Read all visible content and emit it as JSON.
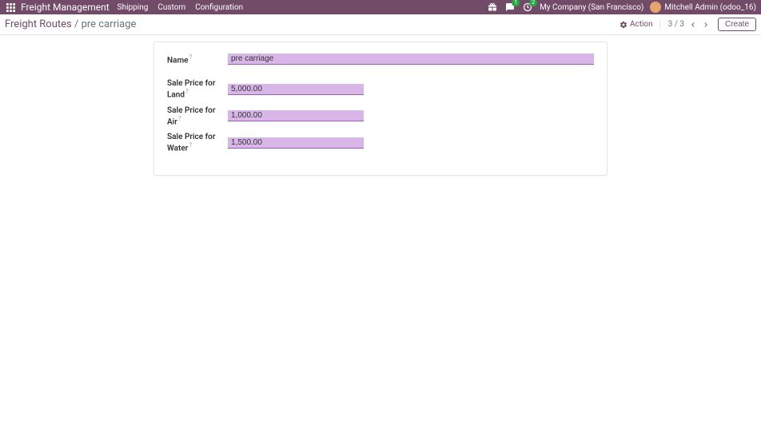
{
  "navbar": {
    "app_title": "Freight Management",
    "menu": [
      "Shipping",
      "Custom",
      "Configuration"
    ],
    "chat_badge": "1",
    "activity_badge": "2",
    "company": "My Company (San Francisco)",
    "user": "Mitchell Admin (odoo_16)"
  },
  "breadcrumb": {
    "root": "Freight Routes",
    "separator": "/",
    "current": "pre carriage"
  },
  "actions": {
    "action_label": "Action",
    "pager": "3 / 3",
    "create_label": "Create"
  },
  "form": {
    "name": {
      "label": "Name",
      "value": "pre carriage"
    },
    "land": {
      "label": "Sale Price for Land",
      "value": "5,000.00"
    },
    "air": {
      "label": "Sale Price for Air",
      "value": "1,000.00"
    },
    "water": {
      "label": "Sale Price for Water",
      "value": "1,500.00"
    }
  }
}
